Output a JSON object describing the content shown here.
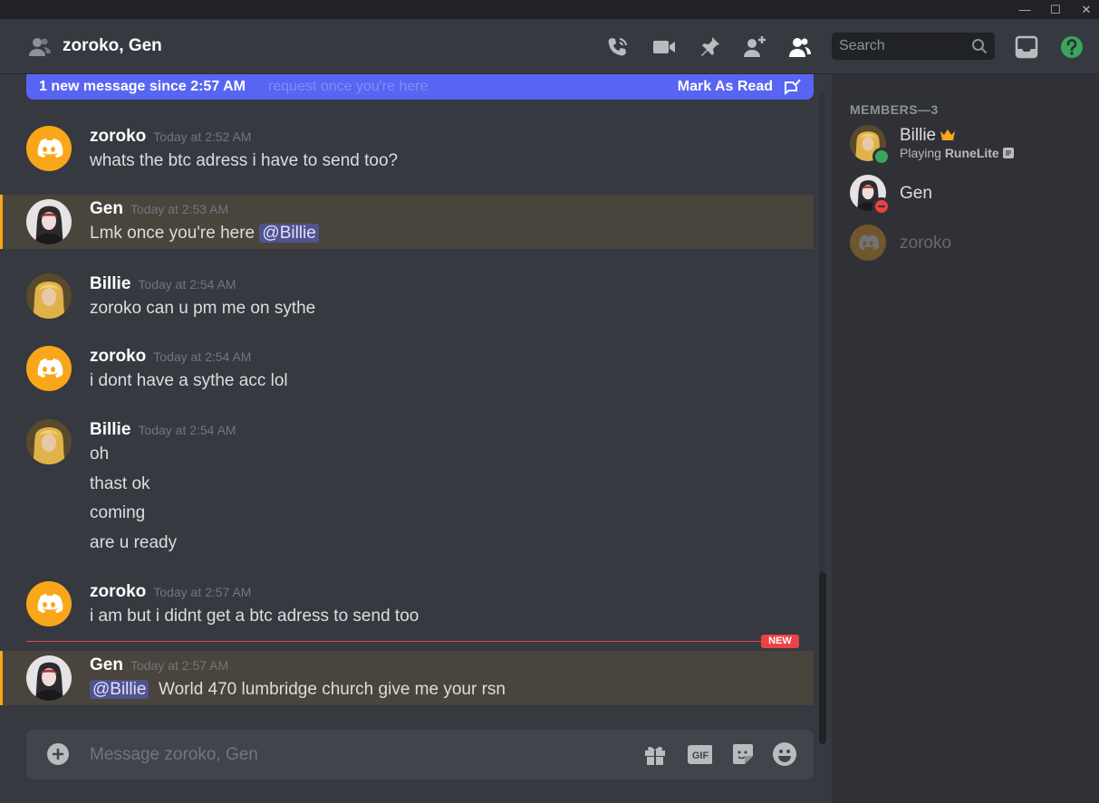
{
  "window": {
    "min": "—",
    "max": "☐",
    "close": "✕"
  },
  "header": {
    "title": "zoroko, Gen",
    "search_placeholder": "Search"
  },
  "banner": {
    "text": "1 new message since 2:57 AM",
    "ghost_text": "request once you're here",
    "mark_read": "Mark As Read"
  },
  "messages": [
    {
      "user": "zoroko",
      "time": "Today at 2:52 AM",
      "lines": [
        "whats the btc adress i have to send too?"
      ]
    },
    {
      "user": "Gen",
      "time": "Today at 2:53 AM",
      "text": "Lmk once you're here",
      "mention": "@Billie"
    },
    {
      "user": "Billie",
      "time": "Today at 2:54 AM",
      "lines": [
        "zoroko can u pm me on sythe"
      ]
    },
    {
      "user": "zoroko",
      "time": "Today at 2:54 AM",
      "lines": [
        "i dont have a sythe acc lol"
      ]
    },
    {
      "user": "Billie",
      "time": "Today at 2:54 AM",
      "lines": [
        "oh",
        "thast ok",
        "coming",
        "are u ready"
      ]
    },
    {
      "user": "zoroko",
      "time": "Today at 2:57 AM",
      "lines": [
        "i am but i didnt get a btc adress to send too"
      ]
    },
    {
      "user": "Gen",
      "time": "Today at 2:57 AM",
      "mention": "@Billie",
      "text": "World 470 lumbridge church give me your rsn"
    }
  ],
  "new_label": "NEW",
  "composer": {
    "placeholder": "Message zoroko, Gen"
  },
  "members": {
    "heading": "MEMBERS—3",
    "list": [
      {
        "name": "Billie",
        "activity_prefix": "Playing ",
        "activity_game": "RuneLite",
        "status": "online"
      },
      {
        "name": "Gen",
        "status": "dnd"
      },
      {
        "name": "zoroko",
        "status": "offline"
      }
    ]
  },
  "colors": {
    "accent": "#5865f2",
    "highlight_border": "#faa81a",
    "online": "#3ba55d",
    "dnd": "#ed4245",
    "help": "#3ba55d"
  }
}
